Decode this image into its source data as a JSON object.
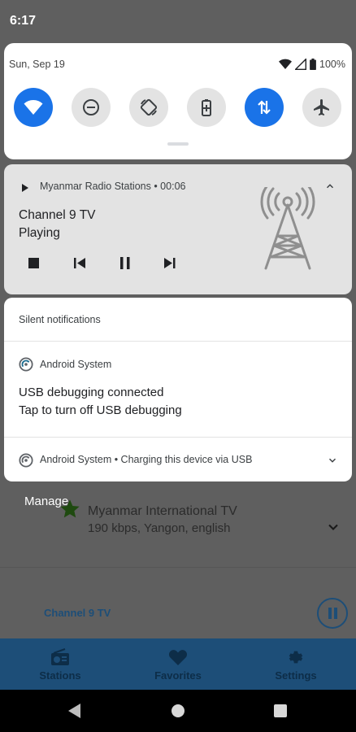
{
  "status_bar": {
    "time": "6:17"
  },
  "quick_settings": {
    "date": "Sun, Sep 19",
    "battery_level": "100%",
    "tiles": [
      {
        "name": "wifi",
        "on": true
      },
      {
        "name": "do-not-disturb",
        "on": false
      },
      {
        "name": "auto-rotate",
        "on": false
      },
      {
        "name": "battery-saver",
        "on": false
      },
      {
        "name": "mobile-data",
        "on": true
      },
      {
        "name": "airplane-mode",
        "on": false
      }
    ]
  },
  "media_notification": {
    "header": "Myanmar Radio Stations • 00:06",
    "title": "Channel 9 TV",
    "subtitle": "Playing",
    "controls": [
      "stop",
      "previous",
      "pause",
      "next"
    ]
  },
  "silent_notifications": {
    "header": "Silent notifications",
    "notification": {
      "app": "Android System",
      "title": "USB debugging connected",
      "text": "Tap to turn off USB debugging"
    },
    "collapsed": {
      "text": "Android System • Charging this device via USB"
    }
  },
  "manage_label": "Manage",
  "background_app": {
    "station_title": "Myanmar International TV",
    "station_details": "190 kbps, Yangon, english",
    "now_playing": "Channel 9 TV",
    "nav": [
      {
        "label": "Stations",
        "icon": "radio-icon"
      },
      {
        "label": "Favorites",
        "icon": "heart-icon"
      },
      {
        "label": "Settings",
        "icon": "gear-icon"
      }
    ]
  },
  "colors": {
    "accent": "#1a73e8",
    "app_bar": "#1d4e78"
  }
}
